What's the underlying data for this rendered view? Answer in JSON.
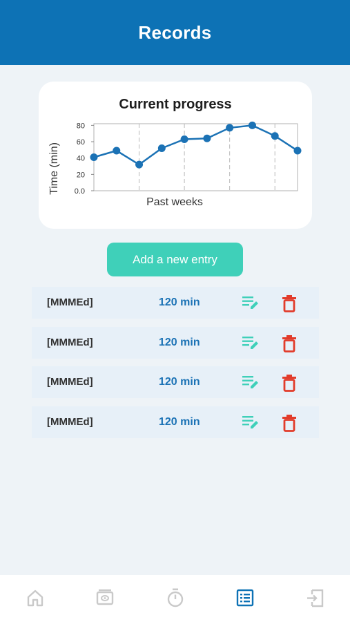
{
  "header": {
    "title": "Records"
  },
  "chart": {
    "title": "Current progress",
    "ylabel": "Time (min)",
    "xlabel": "Past weeks"
  },
  "chart_data": {
    "type": "line",
    "title": "Current progress",
    "xlabel": "Past weeks",
    "ylabel": "Time (min)",
    "x": [
      0,
      1,
      2,
      3,
      4,
      5,
      6,
      7,
      8,
      9
    ],
    "values": [
      41,
      49,
      32,
      52,
      63,
      64,
      77,
      80,
      67,
      49
    ],
    "ylim": [
      0,
      82
    ],
    "yticks": [
      "0.0",
      "20",
      "40",
      "60",
      "80"
    ],
    "grid": "vertical dashed",
    "colors": {
      "line": "#1b72b5",
      "marker": "#1b72b5"
    }
  },
  "actions": {
    "add_label": "Add a new entry"
  },
  "entries": [
    {
      "date": "[MMMEd]",
      "duration": "120 min"
    },
    {
      "date": "[MMMEd]",
      "duration": "120 min"
    },
    {
      "date": "[MMMEd]",
      "duration": "120 min"
    },
    {
      "date": "[MMMEd]",
      "duration": "120 min"
    }
  ],
  "nav": {
    "items": [
      {
        "icon": "home-icon"
      },
      {
        "icon": "video-icon"
      },
      {
        "icon": "stopwatch-icon"
      },
      {
        "icon": "records-list-icon",
        "active": true
      },
      {
        "icon": "logout-icon"
      }
    ]
  },
  "colors": {
    "primary": "#0d72b5",
    "accent": "#3fd0b9",
    "delete": "#e23b2a",
    "inactive_icon": "#c9c9c9"
  }
}
